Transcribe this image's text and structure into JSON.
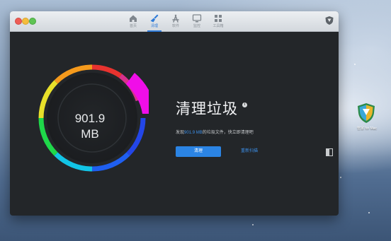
{
  "window": {
    "tabs": [
      {
        "label": "首页",
        "icon": "home-icon",
        "active": false
      },
      {
        "label": "清理",
        "icon": "broom-icon",
        "active": true
      },
      {
        "label": "软件",
        "icon": "app-store-icon",
        "active": false
      },
      {
        "label": "监控",
        "icon": "monitor-icon",
        "active": false
      },
      {
        "label": "工具箱",
        "icon": "toolbox-icon",
        "active": false
      }
    ]
  },
  "cleaner": {
    "size_value": "901.9",
    "size_unit": "MB",
    "title": "清理垃圾",
    "info_glyph": "i",
    "desc_prefix": "发现",
    "desc_highlight": "901.9 MB",
    "desc_suffix": "的垃圾文件，快立即清理吧",
    "clean_button": "清理",
    "rescan_link": "重新扫描"
  },
  "desktop": {
    "app_label": "管家 for Mac"
  },
  "colors": {
    "accent": "#2b84e4",
    "window_bg": "#232629"
  }
}
